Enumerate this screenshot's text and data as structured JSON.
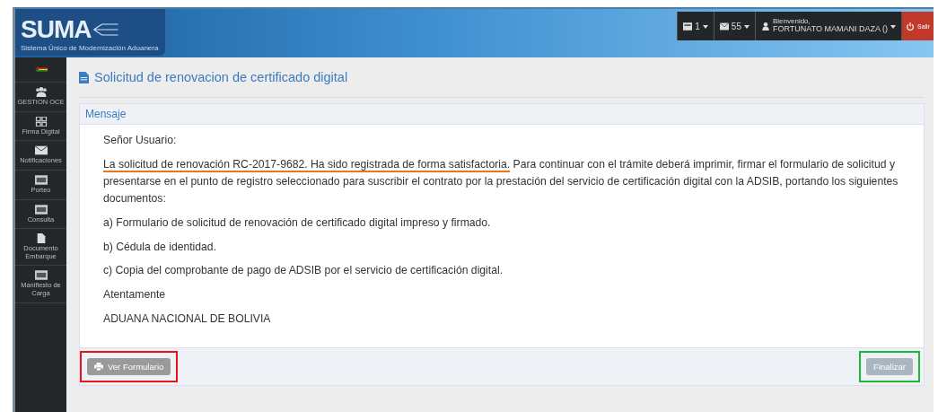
{
  "header": {
    "logo": "SUMA",
    "tagline": "Sistema Único de Modernización Aduanera",
    "tasks_count": "1",
    "messages_count": "55",
    "welcome": "Bienvenido,",
    "user": "FORTUNATO MAMANI DAZA ()",
    "logout": "Salir"
  },
  "sidebar": {
    "items": [
      {
        "kind": "flag"
      },
      {
        "kind": "group",
        "label": "GESTION OCE"
      },
      {
        "kind": "qr",
        "label": "Firma Digital"
      },
      {
        "kind": "mail",
        "label": "Notificaciones"
      },
      {
        "kind": "card",
        "label": "Porteo"
      },
      {
        "kind": "card",
        "label": "Consulta"
      },
      {
        "kind": "file",
        "label": "Documento Embarque"
      },
      {
        "kind": "card",
        "label": "Manifiesto de Carga"
      }
    ]
  },
  "page_title": "Solicitud de renovacion de certificado digital",
  "panel": {
    "heading": "Mensaje",
    "lines": [
      {
        "kind": "text",
        "text": "Señor Usuario:"
      },
      {
        "kind": "marked",
        "marked": "La solicitud de renovación RC-2017-9682. Ha sido registrada de forma satisfactoria.",
        "text": " Para continuar con el trámite deberá imprimir, firmar el formulario de solicitud y presentarse en el punto de registro seleccionado para suscribir el contrato por la prestación del servicio de certificación digital con la ADSIB, portando los siguientes documentos:"
      },
      {
        "kind": "text",
        "text": "a) Formulario de solicitud de renovación de certificado digital impreso y firmado."
      },
      {
        "kind": "text",
        "text": "b) Cédula de identidad."
      },
      {
        "kind": "text",
        "text": "c) Copia del comprobante de pago de ADSIB por el servicio de certificación digital."
      },
      {
        "kind": "text",
        "text": "Atentamente"
      },
      {
        "kind": "text",
        "text": "ADUANA NACIONAL DE BOLIVIA"
      }
    ],
    "buttons": [
      {
        "kind": "print",
        "label": "Ver Formulario",
        "color": "#e8141c"
      },
      {
        "kind": "plain",
        "label": "Finalizar",
        "color": "#1fb535"
      }
    ]
  }
}
